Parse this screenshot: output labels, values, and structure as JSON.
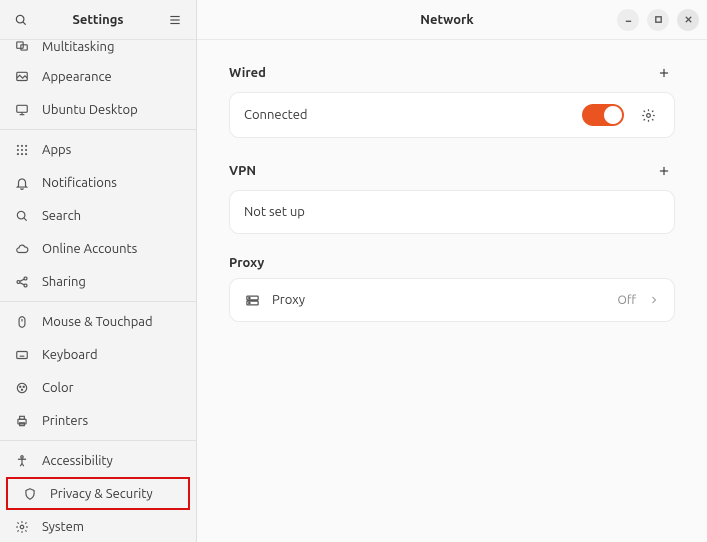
{
  "sidebar": {
    "title": "Settings",
    "items": [
      {
        "id": "multitasking",
        "label": "Multitasking",
        "icon": "multitask-icon"
      },
      {
        "id": "appearance",
        "label": "Appearance",
        "icon": "appearance-icon"
      },
      {
        "id": "ubuntu-desktop",
        "label": "Ubuntu Desktop",
        "icon": "desktop-icon"
      },
      {
        "separator": true
      },
      {
        "id": "apps",
        "label": "Apps",
        "icon": "grid-icon"
      },
      {
        "id": "notifications",
        "label": "Notifications",
        "icon": "bell-icon"
      },
      {
        "id": "search",
        "label": "Search",
        "icon": "search-icon"
      },
      {
        "id": "online-accounts",
        "label": "Online Accounts",
        "icon": "cloud-icon"
      },
      {
        "id": "sharing",
        "label": "Sharing",
        "icon": "share-icon"
      },
      {
        "separator": true
      },
      {
        "id": "mouse-touchpad",
        "label": "Mouse & Touchpad",
        "icon": "mouse-icon"
      },
      {
        "id": "keyboard",
        "label": "Keyboard",
        "icon": "keyboard-icon"
      },
      {
        "id": "color",
        "label": "Color",
        "icon": "color-icon"
      },
      {
        "id": "printers",
        "label": "Printers",
        "icon": "printer-icon"
      },
      {
        "separator": true
      },
      {
        "id": "accessibility",
        "label": "Accessibility",
        "icon": "accessibility-icon"
      },
      {
        "id": "privacy-security",
        "label": "Privacy & Security",
        "icon": "shield-icon",
        "highlighted": true
      },
      {
        "id": "system",
        "label": "System",
        "icon": "gear-icon"
      }
    ]
  },
  "header": {
    "title": "Network"
  },
  "sections": {
    "wired": {
      "title": "Wired",
      "status": "Connected",
      "toggle_on": true
    },
    "vpn": {
      "title": "VPN",
      "status": "Not set up"
    },
    "proxy": {
      "title": "Proxy",
      "row_label": "Proxy",
      "row_value": "Off"
    }
  },
  "colors": {
    "accent": "#e95420"
  }
}
